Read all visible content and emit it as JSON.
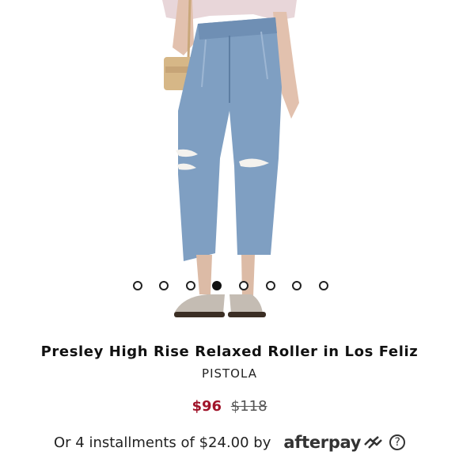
{
  "product": {
    "title": "Presley High Rise Relaxed Roller in Los Feliz",
    "brand": "PISTOLA",
    "sale_price": "$96",
    "original_price": "$118"
  },
  "carousel": {
    "total": 8,
    "active_index": 3
  },
  "payment": {
    "installments_text": "Or 4 installments of $24.00 by",
    "provider": "afterpay",
    "info_glyph": "?"
  },
  "colors": {
    "sale_price": "#a0142a",
    "denim": "#7f9fc2"
  }
}
